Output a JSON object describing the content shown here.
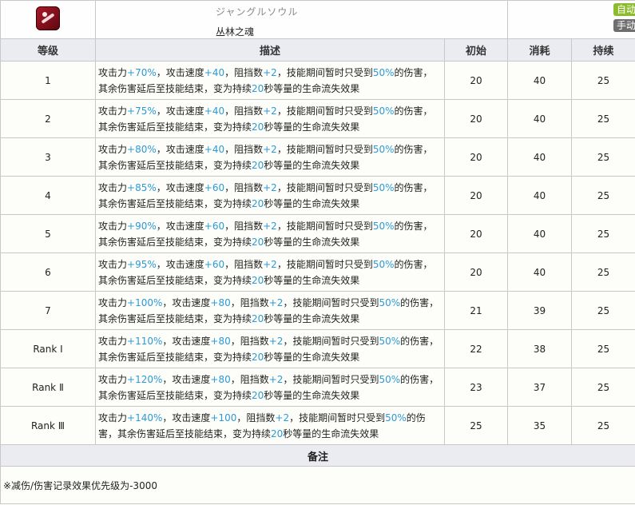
{
  "skill": {
    "name_jp": "ジャングルソウル",
    "name_cn": "丛林之魂",
    "icon": "skill-emblem-icon",
    "tags": [
      "自动回复",
      "手动触发"
    ],
    "tag_colors": {
      "auto": "#8dbb2e",
      "manual": "#6e6e6e"
    }
  },
  "headers": [
    "等级",
    "描述",
    "初始",
    "消耗",
    "持续"
  ],
  "rows": [
    {
      "level": "1",
      "atk": "+70%",
      "spd": "+40",
      "block": "+2",
      "pct": "50%",
      "sec": "20",
      "init": "20",
      "cost": "40",
      "dur": "25"
    },
    {
      "level": "2",
      "atk": "+75%",
      "spd": "+40",
      "block": "+2",
      "pct": "50%",
      "sec": "20",
      "init": "20",
      "cost": "40",
      "dur": "25"
    },
    {
      "level": "3",
      "atk": "+80%",
      "spd": "+40",
      "block": "+2",
      "pct": "50%",
      "sec": "20",
      "init": "20",
      "cost": "40",
      "dur": "25"
    },
    {
      "level": "4",
      "atk": "+85%",
      "spd": "+60",
      "block": "+2",
      "pct": "50%",
      "sec": "20",
      "init": "20",
      "cost": "40",
      "dur": "25"
    },
    {
      "level": "5",
      "atk": "+90%",
      "spd": "+60",
      "block": "+2",
      "pct": "50%",
      "sec": "20",
      "init": "20",
      "cost": "40",
      "dur": "25"
    },
    {
      "level": "6",
      "atk": "+95%",
      "spd": "+60",
      "block": "+2",
      "pct": "50%",
      "sec": "20",
      "init": "20",
      "cost": "40",
      "dur": "25"
    },
    {
      "level": "7",
      "atk": "+100%",
      "spd": "+80",
      "block": "+2",
      "pct": "50%",
      "sec": "20",
      "init": "21",
      "cost": "39",
      "dur": "25"
    },
    {
      "level": "Rank Ⅰ",
      "atk": "+110%",
      "spd": "+80",
      "block": "+2",
      "pct": "50%",
      "sec": "20",
      "init": "22",
      "cost": "38",
      "dur": "25"
    },
    {
      "level": "Rank Ⅱ",
      "atk": "+120%",
      "spd": "+80",
      "block": "+2",
      "pct": "50%",
      "sec": "20",
      "init": "23",
      "cost": "37",
      "dur": "25"
    },
    {
      "level": "Rank Ⅲ",
      "atk": "+140%",
      "spd": "+100",
      "block": "+2",
      "pct": "50%",
      "sec": "20",
      "init": "25",
      "cost": "35",
      "dur": "25"
    }
  ],
  "desc_parts": {
    "p1": "攻击力",
    "p2": "，攻击速度",
    "p3": "，阻挡数",
    "p4": "，技能期间暂时只受到",
    "p5": "的伤害，其余伤害延后至技能结束，变为持续",
    "p6": "秒等量的生命流失效果"
  },
  "notes": {
    "title": "备注",
    "text": "※减伤/伤害记录效果优先级为-3000"
  }
}
